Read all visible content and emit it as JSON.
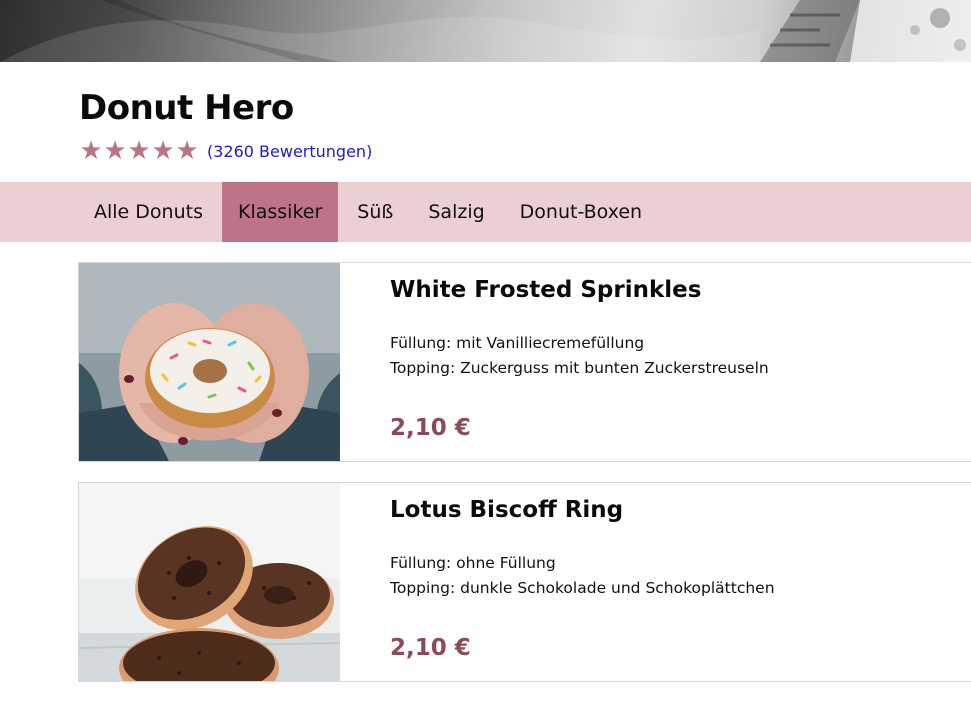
{
  "store": {
    "title": "Donut Hero",
    "rating_stars": 5,
    "reviews_label": "(3260 Bewertungen)",
    "star_color": "#b97586",
    "star_icon": "star-icon"
  },
  "nav": {
    "tabs": [
      {
        "label": "Alle Donuts",
        "active": false
      },
      {
        "label": "Klassiker",
        "active": true
      },
      {
        "label": "Süß",
        "active": false
      },
      {
        "label": "Salzig",
        "active": false
      },
      {
        "label": "Donut-Boxen",
        "active": false
      }
    ],
    "background": "#ebcfd3",
    "active_color": "#bd7487"
  },
  "products": [
    {
      "name": "White Frosted Sprinkles",
      "filling": "Füllung: mit Vanilliecremefüllung",
      "topping": "Topping: Zuckerguss mit bunten Zuckerstreuseln",
      "price": "2,10 €",
      "image": "donut-in-hands-photo"
    },
    {
      "name": "Lotus Biscoff Ring",
      "filling": "Füllung: ohne Füllung",
      "topping": "Topping: dunkle Schokolade und Schokoplättchen",
      "price": "2,10 €",
      "image": "chocolate-donuts-photo"
    }
  ],
  "colors": {
    "price": "#8b4a58",
    "link": "#1c1cc8"
  }
}
